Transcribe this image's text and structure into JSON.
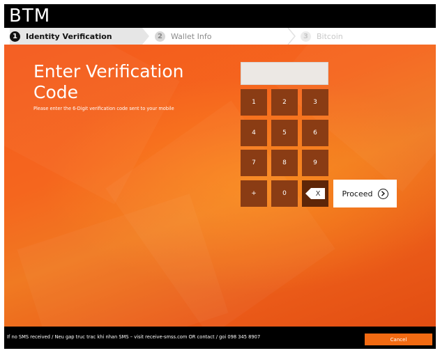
{
  "app": {
    "title": "BTM"
  },
  "steps": [
    {
      "number": "1",
      "label": "Identity Verification",
      "state": "active"
    },
    {
      "number": "2",
      "label": "Wallet Info",
      "state": "pending"
    },
    {
      "number": "3",
      "label": "Bitcoin",
      "state": "pending"
    }
  ],
  "main": {
    "heading": "Enter Verification Code",
    "subtext": "Please enter the 6-Digit verification code sent to your mobile",
    "code_value": ""
  },
  "keypad": {
    "keys": [
      "1",
      "2",
      "3",
      "4",
      "5",
      "6",
      "7",
      "8",
      "9",
      "+",
      "0"
    ],
    "backspace_label": "X",
    "backspace_icon": "backspace-icon"
  },
  "proceed": {
    "label": "Proceed",
    "icon": "chevron-right-circle-icon"
  },
  "footer": {
    "text": "If no SMS received / Neu gap truc trac khi nhan SMS – visit receive-smss.com OR contact / goi 098 345 8907",
    "cancel_label": "Cancel"
  },
  "colors": {
    "background_orange": "#f5661e",
    "key_brown": "#8a3c14",
    "key_back_brown": "#5e2608",
    "cancel_orange": "#f26a12",
    "header_black": "#000000"
  }
}
